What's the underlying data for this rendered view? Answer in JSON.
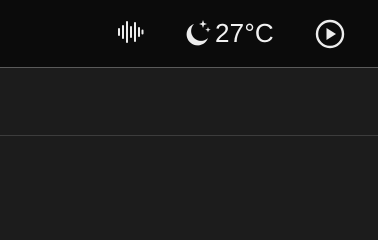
{
  "status_bar": {
    "audio_icon": "sound-waveform-icon",
    "weather": {
      "icon": "moon-stars-icon",
      "temperature": "27°C"
    },
    "play_icon": "play-circle-icon"
  },
  "colors": {
    "status_bar_bg": "#0b0b0b",
    "panel_bg": "#1c1c1c",
    "icon": "#ededed",
    "divider": "#3c3c3c"
  }
}
